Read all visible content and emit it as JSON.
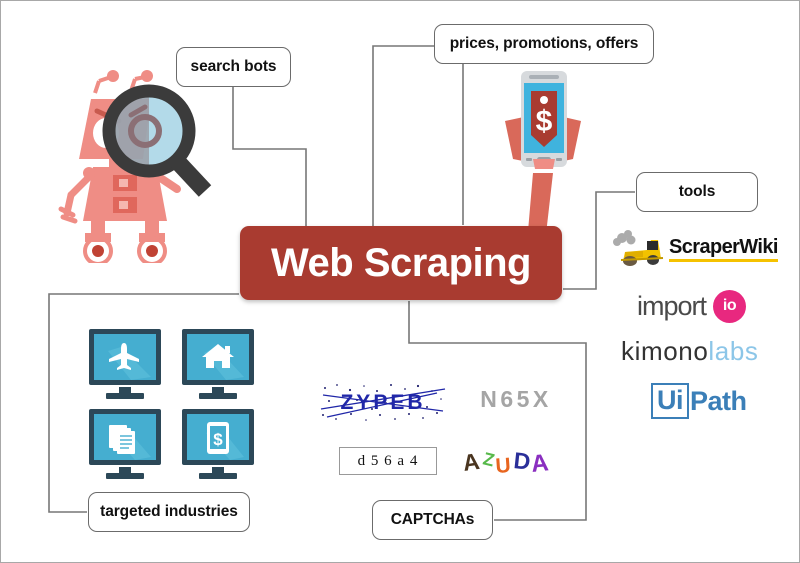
{
  "diagram": {
    "title": "Web Scraping",
    "center_color": "#a93b30",
    "center_text_color": "#ffffff"
  },
  "labels": {
    "search_bots": "search bots",
    "prices": "prices, promotions, offers",
    "tools": "tools",
    "targeted_industries": "targeted industries",
    "captchas": "CAPTCHAs"
  },
  "tools_logos": [
    {
      "name": "ScraperWiki",
      "text": "ScraperWiki",
      "icon": "yellow-scraper-machine-icon",
      "text_color": "#111111",
      "underline_color": "#f5c200"
    },
    {
      "name": "import.io",
      "text_primary": "import",
      "text_badge": "io",
      "text_color": "#4a4a4a",
      "badge_color": "#e8287f"
    },
    {
      "name": "kimonolabs",
      "text_primary": "kimono",
      "text_secondary": "labs",
      "primary_color": "#333333",
      "secondary_color": "#8cc6e8"
    },
    {
      "name": "UiPath",
      "text_boxed": "Ui",
      "text_plain": "Path",
      "color": "#3b7fb8"
    }
  ],
  "captchas": [
    {
      "id": "captcha-zypeb",
      "text": "ZYPEB",
      "style": "blue-noisy-struck-through",
      "color": "#2027a8"
    },
    {
      "id": "captcha-n65x",
      "text": "N65X",
      "style": "gray-blurred",
      "color": "#9a9a9a"
    },
    {
      "id": "captcha-d56a4",
      "text": "d 5 6 a 4",
      "style": "boxed-serif",
      "color": "#111111"
    },
    {
      "id": "captcha-azuda",
      "text": "AZUDA",
      "style": "multicolor-jumbled",
      "colors": [
        "#4a3520",
        "#57b94a",
        "#e8651f",
        "#2a2f99",
        "#8a2fc0"
      ]
    }
  ],
  "targeted_industries_monitors": [
    {
      "icon": "airplane-icon",
      "label": "travel"
    },
    {
      "icon": "house-icon",
      "label": "real-estate"
    },
    {
      "icon": "documents-icon",
      "label": "content"
    },
    {
      "icon": "mobile-money-icon",
      "label": "finance"
    }
  ],
  "illustrations": {
    "robot": "robot-with-magnifying-glass",
    "phone": "hand-holding-phone-with-price-tag",
    "phone_tag_symbol": "$"
  },
  "colors": {
    "monitor_frame": "#2c4858",
    "monitor_screen": "#45aed0",
    "robot_body": "#ef8d85",
    "robot_dark": "#e0675c",
    "magnifier": "#3b3b3b",
    "line": "#777777"
  }
}
